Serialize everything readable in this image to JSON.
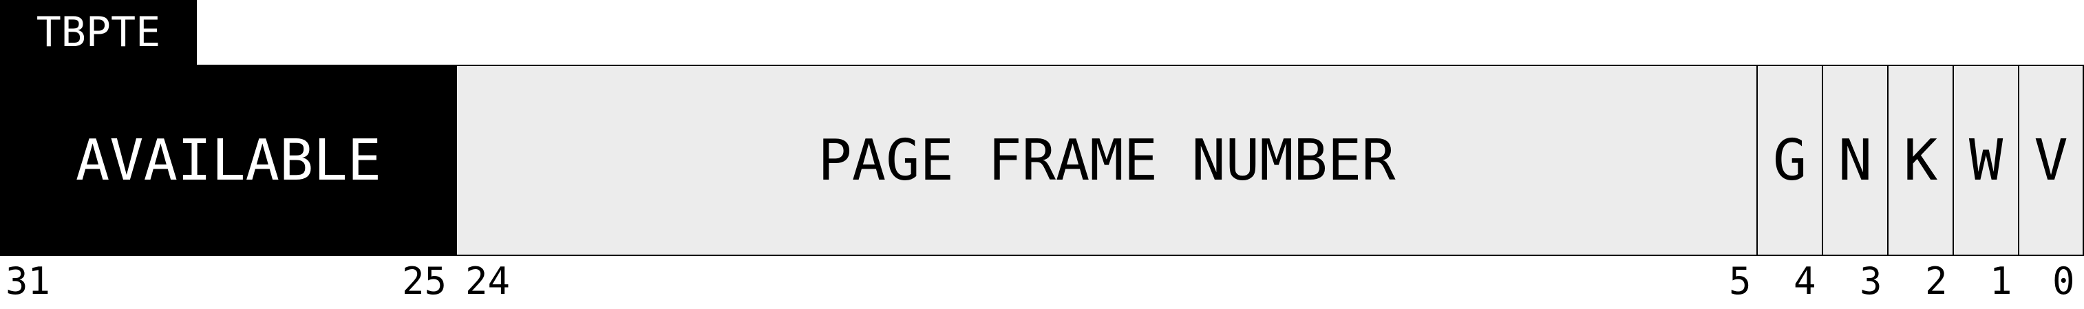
{
  "title": "TBPTE",
  "fields": {
    "available": "AVAILABLE",
    "page_frame_number": "PAGE FRAME NUMBER",
    "g": "G",
    "n": "N",
    "k": "K",
    "w": "W",
    "v": "V"
  },
  "bits": {
    "b31": "31",
    "b25": "25",
    "b24": "24",
    "b5": "5",
    "b4": "4",
    "b3": "3",
    "b2": "2",
    "b1": "1",
    "b0": "0"
  },
  "colors": {
    "black": "#000000",
    "field_fill": "#ececec",
    "white": "#ffffff"
  }
}
